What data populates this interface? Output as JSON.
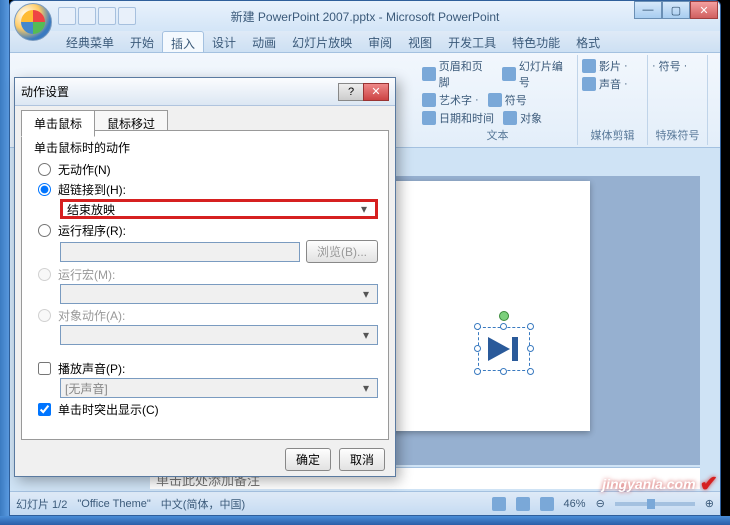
{
  "window": {
    "title": "新建 PowerPoint 2007.pptx - Microsoft PowerPoint",
    "min": "—",
    "max": "▢",
    "close": "✕"
  },
  "tabs": {
    "items": [
      "经典菜单",
      "开始",
      "插入",
      "设计",
      "动画",
      "幻灯片放映",
      "审阅",
      "视图",
      "开发工具",
      "特色功能",
      "格式"
    ],
    "active_index": 2
  },
  "ribbon": {
    "grp1": {
      "items": [
        "页眉和页脚",
        "幻灯片编号",
        "艺术字",
        "符号",
        "日期和时间",
        "对象"
      ],
      "label": "文本"
    },
    "grp2": {
      "items": [
        "影片",
        "声音"
      ],
      "label": "媒体剪辑"
    },
    "grp3": {
      "items": [
        "符号"
      ],
      "label": "特殊符号"
    }
  },
  "dialog": {
    "title": "动作设置",
    "help": "?",
    "close": "✕",
    "tabs": {
      "click": "单击鼠标",
      "hover": "鼠标移过"
    },
    "group_label": "单击鼠标时的动作",
    "opts": {
      "none": "无动作(N)",
      "hyperlink": "超链接到(H):",
      "hyperlink_value": "结束放映",
      "run_prog": "运行程序(R):",
      "browse": "浏览(B)...",
      "run_macro": "运行宏(M):",
      "obj_action": "对象动作(A):"
    },
    "sound": {
      "play": "播放声音(P):",
      "value": "[无声音]",
      "highlight": "单击时突出显示(C)"
    },
    "ok": "确定",
    "cancel": "取消"
  },
  "notes": {
    "placeholder": "单击此处添加备注"
  },
  "status": {
    "slide": "幻灯片 1/2",
    "theme": "\"Office Theme\"",
    "lang": "中文(简体，中国)",
    "zoom": "46%"
  },
  "watermark": {
    "text": "jingyanla.com"
  }
}
